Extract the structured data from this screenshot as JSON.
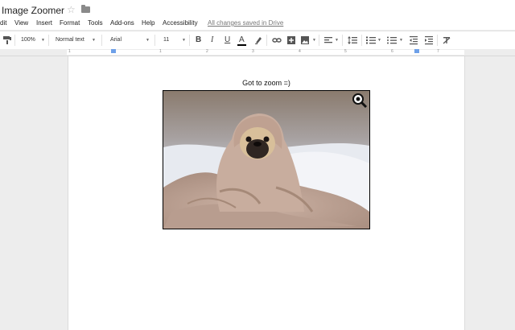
{
  "doc": {
    "title": "Image Zoomer"
  },
  "menu": {
    "items": [
      "dit",
      "View",
      "Insert",
      "Format",
      "Tools",
      "Add-ons",
      "Help",
      "Accessibility"
    ],
    "save_status": "All changes saved in Drive"
  },
  "toolbar": {
    "zoom": "100%",
    "style": "Normal text",
    "font": "Arial",
    "size": "11"
  },
  "ruler": {
    "numbers": [
      "1",
      "1",
      "2",
      "3",
      "4",
      "5",
      "6",
      "7"
    ]
  },
  "page": {
    "caption": "Got to zoom =)",
    "image_subject": "pug wrapped in a pink blanket on a bed",
    "zoom_icon": "magnifier-zoom-icon"
  }
}
